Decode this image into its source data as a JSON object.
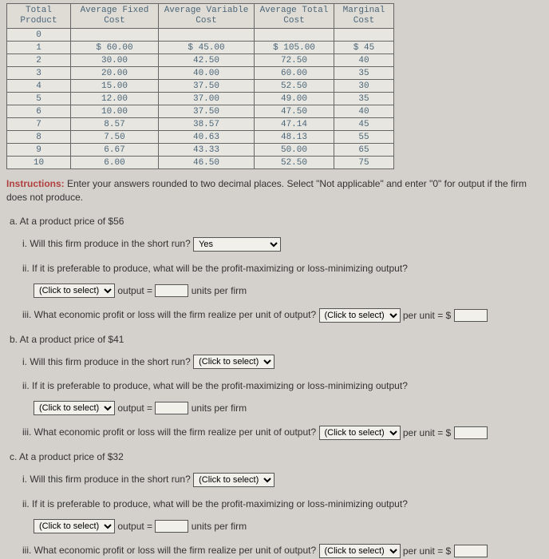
{
  "table": {
    "headers": [
      "Total Product",
      "Average Fixed Cost",
      "Average Variable Cost",
      "Average Total Cost",
      "Marginal Cost"
    ],
    "rows": [
      [
        "0",
        "",
        "",
        "",
        ""
      ],
      [
        "1",
        "$ 60.00",
        "$ 45.00",
        "$ 105.00",
        "$ 45"
      ],
      [
        "2",
        "30.00",
        "42.50",
        "72.50",
        "40"
      ],
      [
        "3",
        "20.00",
        "40.00",
        "60.00",
        "35"
      ],
      [
        "4",
        "15.00",
        "37.50",
        "52.50",
        "30"
      ],
      [
        "5",
        "12.00",
        "37.00",
        "49.00",
        "35"
      ],
      [
        "6",
        "10.00",
        "37.50",
        "47.50",
        "40"
      ],
      [
        "7",
        "8.57",
        "38.57",
        "47.14",
        "45"
      ],
      [
        "8",
        "7.50",
        "40.63",
        "48.13",
        "55"
      ],
      [
        "9",
        "6.67",
        "43.33",
        "50.00",
        "65"
      ],
      [
        "10",
        "6.00",
        "46.50",
        "52.50",
        "75"
      ]
    ]
  },
  "instructions": {
    "lead": "Instructions:",
    "text": " Enter your answers rounded to two decimal places. Select \"Not applicable\" and enter \"0\" for output if the firm does not produce."
  },
  "parts": {
    "a": {
      "title": "a. At a product price of $56",
      "q1": "i. Will this firm produce in the short run?",
      "q1_sel": "Yes",
      "q2": "ii. If it is preferable to produce, what will be the profit-maximizing or loss-minimizing output?",
      "q2_sel": "(Click to select)",
      "q2_output": "output =",
      "q2_units": "units per firm",
      "q3a": "iii. What economic profit or loss will the firm realize per unit of output?",
      "q3_sel": "(Click to select)",
      "q3b": "per unit = $"
    },
    "b": {
      "title": "b. At a product price of $41",
      "q1": "i. Will this firm produce in the short run?",
      "q1_sel": "(Click to select)",
      "q2": "ii. If it is preferable to produce, what will be the profit-maximizing or loss-minimizing output?",
      "q2_sel": "(Click to select)",
      "q2_output": "output =",
      "q2_units": "units per firm",
      "q3a": "iii. What economic profit or loss will the firm realize per unit of output?",
      "q3_sel": "(Click to select)",
      "q3b": "per unit = $"
    },
    "c": {
      "title": "c. At a product price of $32",
      "q1": "i. Will this firm produce in the short run?",
      "q1_sel": "(Click to select)",
      "q2": "ii. If it is preferable to produce, what will be the profit-maximizing or loss-minimizing output?",
      "q2_sel": "(Click to select)",
      "q2_output": "output =",
      "q2_units": "units per firm",
      "q3a": "iii. What economic profit or loss will the firm realize per unit of output?",
      "q3_sel": "(Click to select)",
      "q3b": "per unit = $"
    }
  }
}
